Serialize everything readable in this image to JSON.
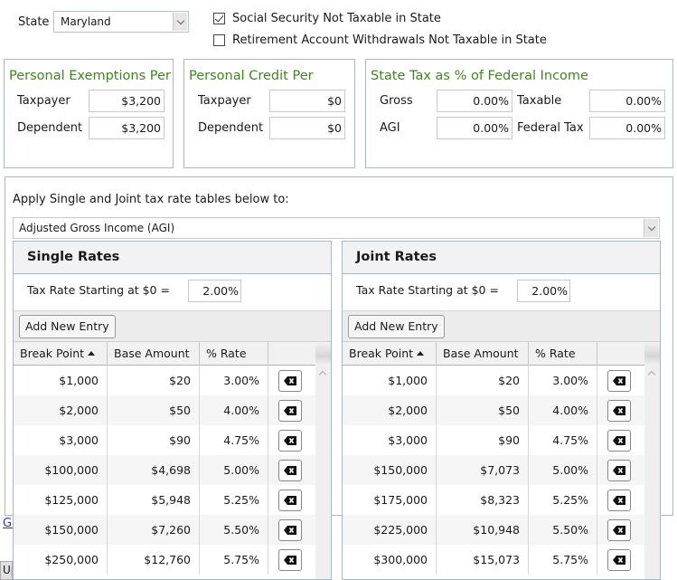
{
  "top": {
    "state_label": "State",
    "state_value": "Maryland",
    "checkboxes": [
      {
        "label": "Social Security Not Taxable in State",
        "checked": true
      },
      {
        "label": "Retirement Account Withdrawals Not Taxable in State",
        "checked": false
      }
    ]
  },
  "exemptions": {
    "title": "Personal Exemptions Per",
    "taxpayer_label": "Taxpayer",
    "taxpayer_value": "$3,200",
    "dependent_label": "Dependent",
    "dependent_value": "$3,200"
  },
  "credit": {
    "title": "Personal Credit Per",
    "taxpayer_label": "Taxpayer",
    "taxpayer_value": "$0",
    "dependent_label": "Dependent",
    "dependent_value": "$0"
  },
  "state_tax_pct": {
    "title": "State Tax as % of Federal Income",
    "gross_label": "Gross",
    "gross_value": "0.00%",
    "taxable_label": "Taxable",
    "taxable_value": "0.00%",
    "agi_label": "AGI",
    "agi_value": "0.00%",
    "federal_tax_label": "Federal Tax",
    "federal_tax_value": "0.00%"
  },
  "apply": {
    "label": "Apply Single and Joint tax rate tables below to:",
    "selected": "Adjusted Gross Income (AGI)"
  },
  "columns": {
    "break_point": "Break Point",
    "base_amount": "Base Amount",
    "rate": "% Rate"
  },
  "add_new_entry": "Add New Entry",
  "single": {
    "title": "Single Rates",
    "start_label": "Tax Rate Starting at $0 =",
    "start_value": "2.00%",
    "rows": [
      {
        "break_point": "$1,000",
        "base_amount": "$20",
        "rate": "3.00%"
      },
      {
        "break_point": "$2,000",
        "base_amount": "$50",
        "rate": "4.00%"
      },
      {
        "break_point": "$3,000",
        "base_amount": "$90",
        "rate": "4.75%"
      },
      {
        "break_point": "$100,000",
        "base_amount": "$4,698",
        "rate": "5.00%"
      },
      {
        "break_point": "$125,000",
        "base_amount": "$5,948",
        "rate": "5.25%"
      },
      {
        "break_point": "$150,000",
        "base_amount": "$7,260",
        "rate": "5.50%"
      },
      {
        "break_point": "$250,000",
        "base_amount": "$12,760",
        "rate": "5.75%"
      }
    ]
  },
  "joint": {
    "title": "Joint Rates",
    "start_label": "Tax Rate Starting at $0 =",
    "start_value": "2.00%",
    "rows": [
      {
        "break_point": "$1,000",
        "base_amount": "$20",
        "rate": "3.00%"
      },
      {
        "break_point": "$2,000",
        "base_amount": "$50",
        "rate": "4.00%"
      },
      {
        "break_point": "$3,000",
        "base_amount": "$90",
        "rate": "4.75%"
      },
      {
        "break_point": "$150,000",
        "base_amount": "$7,073",
        "rate": "5.00%"
      },
      {
        "break_point": "$175,000",
        "base_amount": "$8,323",
        "rate": "5.25%"
      },
      {
        "break_point": "$225,000",
        "base_amount": "$10,948",
        "rate": "5.50%"
      },
      {
        "break_point": "$300,000",
        "base_amount": "$15,073",
        "rate": "5.75%"
      }
    ]
  },
  "partial": {
    "link_text": "Go",
    "button_text": "Up"
  },
  "colors": {
    "group_title": "#3a8a1a",
    "border": "#aab8c2",
    "link": "#1a3fcc"
  }
}
